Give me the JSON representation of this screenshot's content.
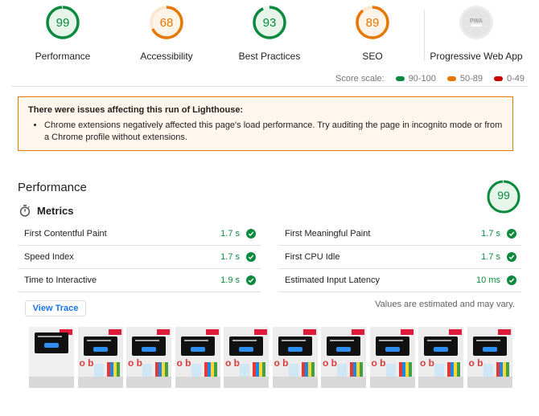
{
  "colors": {
    "pass": "#0b8a3e",
    "average": "#e67700",
    "fail": "#cc0000",
    "pwa_gray": "#c8c8c8"
  },
  "categories": [
    {
      "id": "performance",
      "label": "Performance",
      "score": "99",
      "fraction": 0.99,
      "status": "pass"
    },
    {
      "id": "accessibility",
      "label": "Accessibility",
      "score": "68",
      "fraction": 0.68,
      "status": "average"
    },
    {
      "id": "best-practices",
      "label": "Best Practices",
      "score": "93",
      "fraction": 0.93,
      "status": "pass"
    },
    {
      "id": "seo",
      "label": "SEO",
      "score": "89",
      "fraction": 0.89,
      "status": "average"
    }
  ],
  "pwa": {
    "label": "Progressive Web App",
    "badge_text": "PWA"
  },
  "score_scale": {
    "label": "Score scale:",
    "ranges": [
      {
        "text": "90-100",
        "status": "pass"
      },
      {
        "text": "50-89",
        "status": "average"
      },
      {
        "text": "0-49",
        "status": "fail"
      }
    ]
  },
  "warning": {
    "title": "There were issues affecting this run of Lighthouse:",
    "items": [
      "Chrome extensions negatively affected this page's load performance. Try auditing the page in incognito mode or from a Chrome profile without extensions."
    ]
  },
  "performance": {
    "title": "Performance",
    "score": "99",
    "fraction": 0.99,
    "metrics_title": "Metrics",
    "metrics_icon": "stopwatch-icon",
    "metrics_left": [
      {
        "name": "First Contentful Paint",
        "value": "1.7 s"
      },
      {
        "name": "Speed Index",
        "value": "1.7 s"
      },
      {
        "name": "Time to Interactive",
        "value": "1.9 s"
      }
    ],
    "metrics_right": [
      {
        "name": "First Meaningful Paint",
        "value": "1.7 s"
      },
      {
        "name": "First CPU Idle",
        "value": "1.7 s"
      },
      {
        "name": "Estimated Input Latency",
        "value": "10 ms"
      }
    ],
    "view_trace_label": "View Trace",
    "estimate_note": "Values are estimated and may vary.",
    "filmstrip_count": 10
  }
}
